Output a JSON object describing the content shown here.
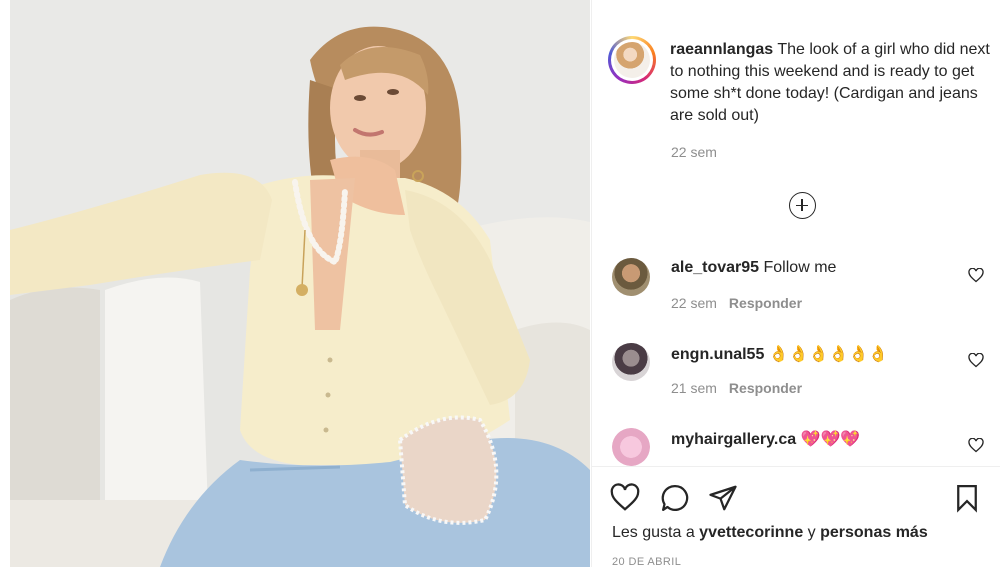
{
  "post": {
    "image_alt": "Woman in cream ribbed cardigan and ripped light-wash jeans sitting on a white sofa"
  },
  "caption": {
    "username": "raeannlangas",
    "text": " The look of a girl who did next to nothing this weekend and is ready to get some sh*t done today! (Cardigan and jeans are sold out)",
    "time": "22 sem"
  },
  "comments": [
    {
      "username": "ale_tovar95",
      "text": " Follow me",
      "time": "22 sem",
      "reply_label": "Responder"
    },
    {
      "username": "engn.unal55",
      "text": " 👌👌👌👌👌👌",
      "time": "21 sem",
      "reply_label": "Responder"
    },
    {
      "username": "myhairgallery.ca",
      "text": " 💖💖💖",
      "time": "",
      "reply_label": ""
    }
  ],
  "likes": {
    "prefix": "Les gusta a ",
    "user": "yvettecorinne",
    "connector": " y ",
    "others": "personas más"
  },
  "date": "20 DE ABRIL",
  "colors": {
    "text": "#262626",
    "muted": "#8e8e8e",
    "border": "#efefef",
    "heart_emoji": "#e84c9d"
  },
  "icons": [
    "heart-icon",
    "comment-icon",
    "share-icon",
    "bookmark-icon",
    "plus-circle-icon"
  ]
}
